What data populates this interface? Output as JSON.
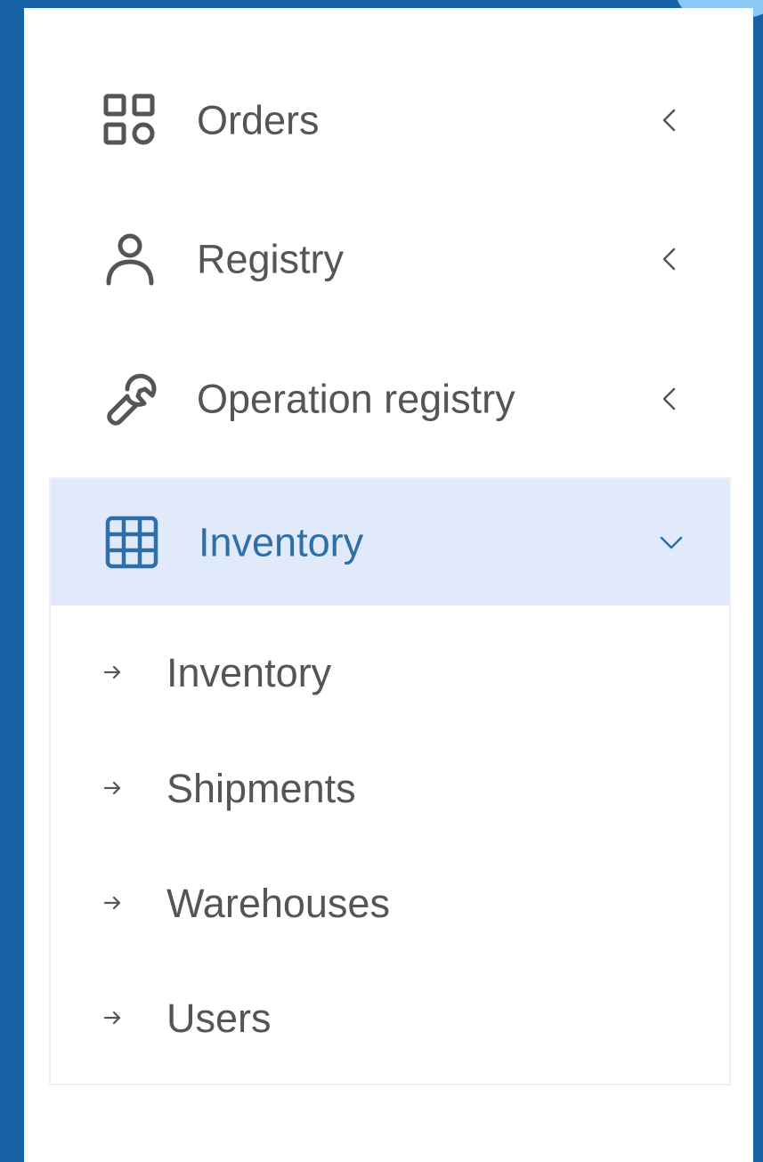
{
  "colors": {
    "background": "#1761a5",
    "panel": "#ffffff",
    "text": "#555555",
    "active_bg": "#e0eafa",
    "active_text": "#2f6fa8"
  },
  "sidebar": {
    "items": [
      {
        "label": "Orders",
        "icon": "grid-apps-icon",
        "chevron": "chevron-left-icon",
        "expanded": false
      },
      {
        "label": "Registry",
        "icon": "user-icon",
        "chevron": "chevron-left-icon",
        "expanded": false
      },
      {
        "label": "Operation registry",
        "icon": "wrench-icon",
        "chevron": "chevron-left-icon",
        "expanded": false
      },
      {
        "label": "Inventory",
        "icon": "table-grid-icon",
        "chevron": "chevron-down-icon",
        "expanded": true,
        "children": [
          {
            "label": "Inventory",
            "icon": "arrow-right-icon"
          },
          {
            "label": "Shipments",
            "icon": "arrow-right-icon"
          },
          {
            "label": "Warehouses",
            "icon": "arrow-right-icon"
          },
          {
            "label": "Users",
            "icon": "arrow-right-icon"
          }
        ]
      }
    ]
  }
}
